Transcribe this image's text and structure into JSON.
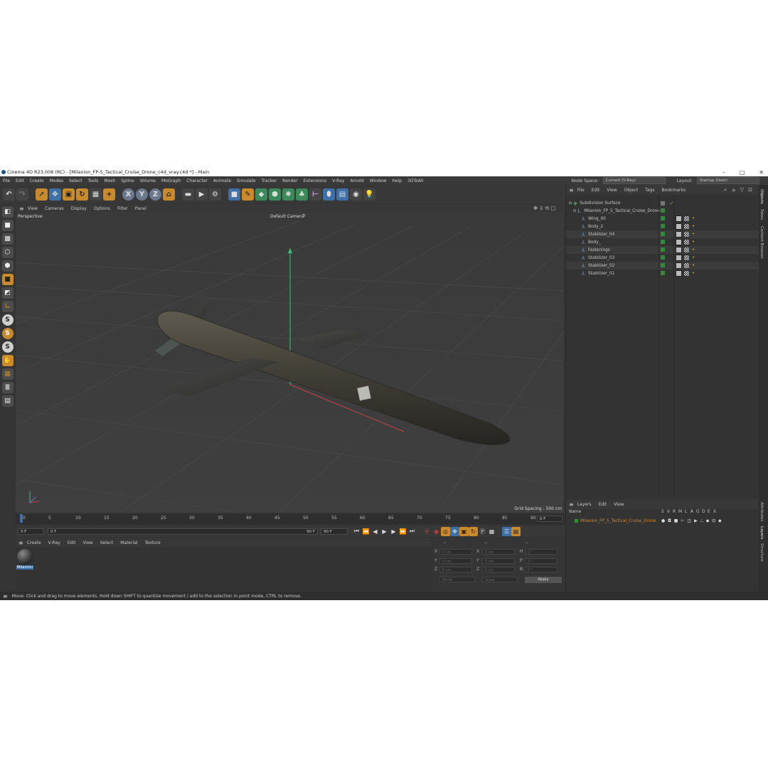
{
  "window": {
    "title": "Cinema 4D R23.008 (RC) - [Milanion_FP-5_Tactical_Cruise_Drone_c4d_vray.c4d *] - Main",
    "controls": [
      "–",
      "□",
      "✕"
    ]
  },
  "menubar": {
    "items": [
      "File",
      "Edit",
      "Create",
      "Modes",
      "Select",
      "Tools",
      "Mesh",
      "Spline",
      "Volume",
      "MoGraph",
      "Character",
      "Animate",
      "Simulate",
      "Tracker",
      "Render",
      "Extensions",
      "V-Ray",
      "Arnold",
      "Window",
      "Help",
      "3DToAll"
    ],
    "node_space_label": "Node Space:",
    "node_space_value": "Current (V-Ray)",
    "layout_label": "Layout:",
    "layout_value": "Startup (User)"
  },
  "viewport": {
    "menu": [
      "View",
      "Cameras",
      "Display",
      "Options",
      "Filter",
      "Panel"
    ],
    "projection": "Perspective",
    "camera": "Default Camera",
    "grid_spacing": "Grid Spacing : 500 cm"
  },
  "timeline": {
    "ticks": [
      "0",
      "5",
      "10",
      "15",
      "20",
      "25",
      "30",
      "35",
      "40",
      "45",
      "50",
      "55",
      "60",
      "65",
      "70",
      "75",
      "80",
      "85",
      "90"
    ],
    "current_frame": "0 F"
  },
  "playbar": {
    "start": "0 F",
    "min": "0 F",
    "max": "90 F",
    "end": "90 F"
  },
  "material_manager": {
    "menu": [
      "Create",
      "V-Ray",
      "Edit",
      "View",
      "Select",
      "Material",
      "Texture"
    ],
    "materials": [
      {
        "name": "Milanion"
      }
    ]
  },
  "coordinates": {
    "header": [
      "--",
      "--",
      "--"
    ],
    "rows": [
      {
        "axis": "X",
        "pos": "0 cm",
        "size_axis": "X",
        "size": "0 cm",
        "rot_axis": "H",
        "rot": "0 °"
      },
      {
        "axis": "Y",
        "pos": "0 cm",
        "size_axis": "Y",
        "size": "0 cm",
        "rot_axis": "P",
        "rot": "0 °"
      },
      {
        "axis": "Z",
        "pos": "0 cm",
        "size_axis": "Z",
        "size": "0 cm",
        "rot_axis": "B",
        "rot": "0 °"
      }
    ],
    "mode": "World",
    "scale": "Scale",
    "apply": "Apply"
  },
  "object_manager": {
    "menu": [
      "File",
      "Edit",
      "View",
      "Object",
      "Tags",
      "Bookmarks"
    ],
    "objects": [
      {
        "name": "Subdivision Surface",
        "level": 0
      },
      {
        "name": "Milanion_FP_5_Tactical_Cruise_Drone",
        "level": 1
      },
      {
        "name": "Wing_00",
        "level": 2
      },
      {
        "name": "Body_2",
        "level": 2
      },
      {
        "name": "Stabilizer_04",
        "level": 2
      },
      {
        "name": "Body_",
        "level": 2
      },
      {
        "name": "Fastenings",
        "level": 2
      },
      {
        "name": "Stabilizer_03",
        "level": 2
      },
      {
        "name": "Stabilizer_02",
        "level": 2
      },
      {
        "name": "Stabilizer_01",
        "level": 2
      }
    ]
  },
  "layer_manager": {
    "menu": [
      "Layers",
      "Edit",
      "View"
    ],
    "name_header": "Name",
    "flags": [
      "S",
      "V",
      "R",
      "M",
      "L",
      "A",
      "G",
      "D",
      "E",
      "X"
    ],
    "layers": [
      {
        "name": "Milanion_FP_5_Tactical_Cruise_Drone",
        "color": "#d38a2a"
      }
    ]
  },
  "right_tabs": [
    "Objects",
    "Takes",
    "Content Browser",
    "Attributes",
    "Layers",
    "Structure"
  ],
  "status": "Move: Click and drag to move elements. Hold down SHIFT to quantize movement / add to the selection in point mode, CTRL to remove.",
  "colors": {
    "accent": "#c98a2c",
    "blue": "#3d6fa8",
    "layer": "#d38a2a",
    "green": "#2f8a3a"
  }
}
